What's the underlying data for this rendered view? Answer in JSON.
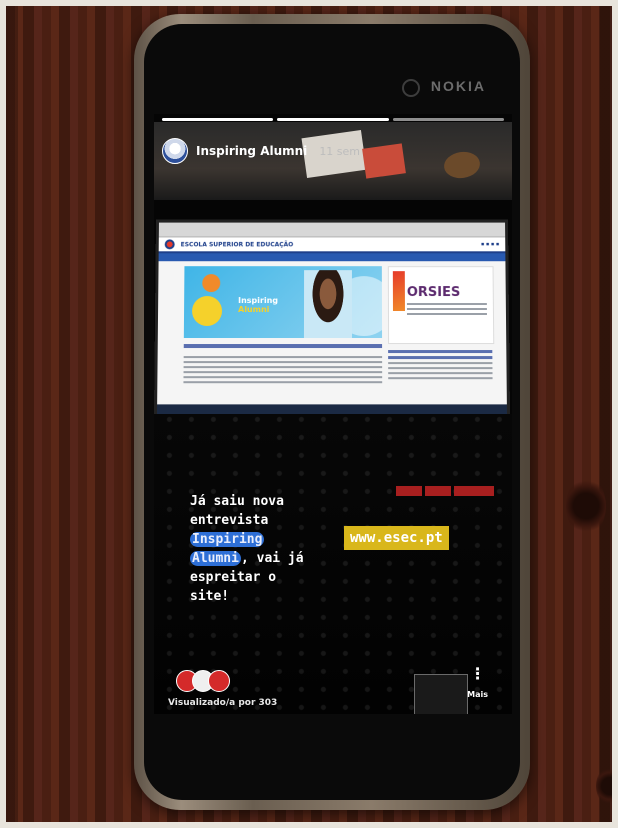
{
  "phone": {
    "brand": "NOKIA"
  },
  "story": {
    "account_name": "Inspiring Alumni",
    "post_time": "11 sem",
    "progress_segments": 3,
    "text_lines": [
      {
        "text": "Já saiu nova",
        "highlight": false
      },
      {
        "text": "entrevista",
        "highlight": false
      },
      {
        "text": "Inspiring",
        "highlight": true
      },
      {
        "text": "Alumni",
        "highlight": true,
        "suffix": ", vai já"
      },
      {
        "text": "espreitar o",
        "highlight": false
      },
      {
        "text": "site!",
        "highlight": false
      }
    ],
    "url_sticker": "www.esec.pt",
    "viewed_by": "Visualizado/a por 303",
    "more_label": "Mais"
  },
  "website": {
    "site_title": "ESCOLA SUPERIOR DE EDUCAÇÃO",
    "hero_tag_line1": "Inspiring",
    "hero_tag_line2": "Alumni",
    "side_ad_title": "ORSIES"
  },
  "colors": {
    "highlight": "#2e6fd6",
    "sticker": "#d9b71b",
    "accent_red": "#d42a2a",
    "site_blue": "#1e3f8a"
  }
}
